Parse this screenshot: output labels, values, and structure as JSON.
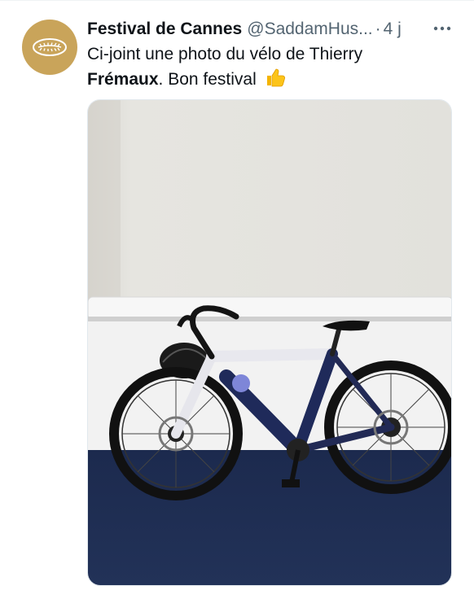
{
  "tweet": {
    "display_name": "Festival de Cannes",
    "handle": "@SaddamHus...",
    "separator": "·",
    "timestamp": "4 j",
    "text_part1": "Ci-joint une photo du vélo de Thierry",
    "text_bold": "Frémaux",
    "text_part2": ". Bon festival",
    "emoji": "thumbs-up-icon"
  },
  "colors": {
    "avatar_gold": "#c9a45a",
    "secondary_text": "#536471"
  }
}
